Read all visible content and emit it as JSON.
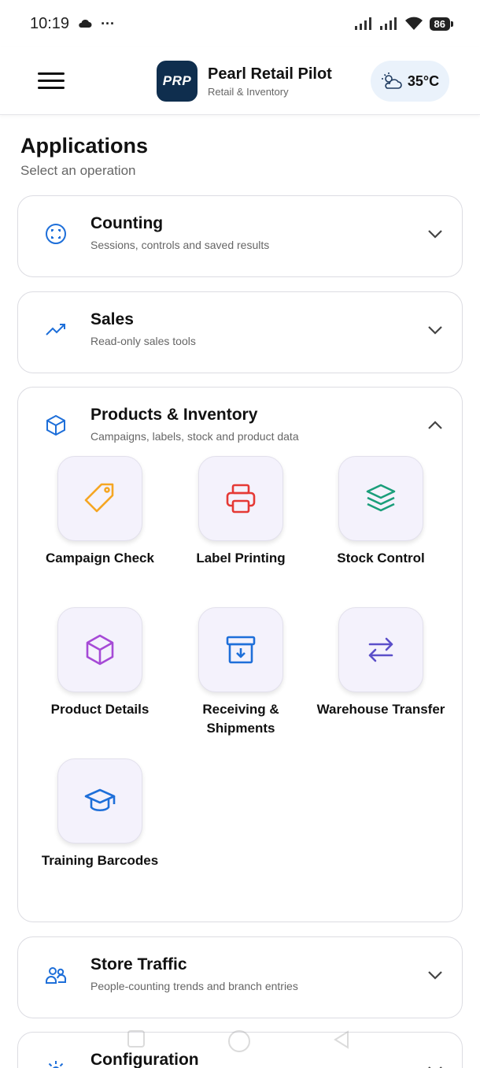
{
  "status_bar": {
    "time": "10:19",
    "dots": "···",
    "battery": "86"
  },
  "header": {
    "logo_text": "PRP",
    "title": "Pearl Retail Pilot",
    "subtitle": "Retail & Inventory",
    "weather_temp": "35°C",
    "weather_icon": "partly-cloudy-icon"
  },
  "applications": {
    "title": "Applications",
    "subtitle": "Select an operation"
  },
  "sections": [
    {
      "title": "Counting",
      "desc": "Sessions, controls and saved results",
      "icon": "scan-icon",
      "expanded": false
    },
    {
      "title": "Sales",
      "desc": "Read-only sales tools",
      "icon": "trend-up-icon",
      "expanded": false
    },
    {
      "title": "Products & Inventory",
      "desc": "Campaigns, labels, stock and product data",
      "icon": "box-icon",
      "expanded": true
    },
    {
      "title": "Store Traffic",
      "desc": "People-counting trends and branch entries",
      "icon": "users-icon",
      "expanded": false
    },
    {
      "title": "Configuration",
      "desc": "",
      "icon": "gear-icon",
      "expanded": false
    }
  ],
  "tiles": [
    {
      "label": "Campaign Check",
      "icon": "tag-icon",
      "color": "#f5a623"
    },
    {
      "label": "Label Printing",
      "icon": "printer-icon",
      "color": "#e53935"
    },
    {
      "label": "Stock Control",
      "icon": "layers-icon",
      "color": "#1a9e7a"
    },
    {
      "label": "Product Details",
      "icon": "cube-icon",
      "color": "#a64ad6"
    },
    {
      "label": "Receiving & Shipments",
      "icon": "archive-download-icon",
      "color": "#1e6fd9"
    },
    {
      "label": "Warehouse Transfer",
      "icon": "transfer-arrows-icon",
      "color": "#5b4fc9"
    },
    {
      "label": "Training Barcodes",
      "icon": "graduation-cap-icon",
      "color": "#1e6fd9"
    }
  ],
  "colors": {
    "accent": "#1e6fd9",
    "logo_bg": "#0f2e4e",
    "tile_bg": "#f4f2fc"
  }
}
